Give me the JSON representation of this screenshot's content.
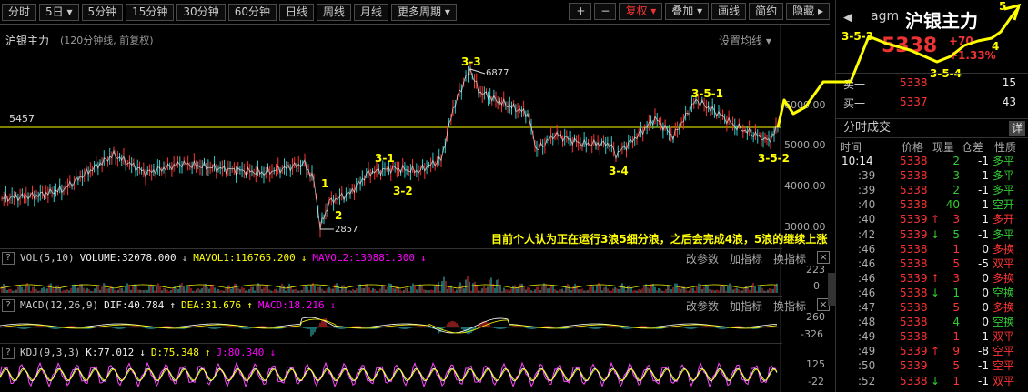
{
  "toolbar": {
    "left": [
      "分时",
      "5日 ▾",
      "5分钟",
      "15分钟",
      "30分钟",
      "60分钟",
      "日线",
      "周线",
      "月线",
      "更多周期 ▾"
    ],
    "right": [
      "+",
      "−",
      "复权 ▾",
      "叠加 ▾",
      "画线",
      "简约",
      "隐藏 ▸"
    ]
  },
  "chart": {
    "title": "沪银主力",
    "subtitle": "(120分钟线, 前复权)",
    "settings": "设置均线 ▾",
    "ref_line_label": "5457",
    "y_labels": [
      "6000.00",
      "5000.00",
      "4000.00",
      "3000.00"
    ],
    "high_note": "6877",
    "low_note": "2857",
    "waves": [
      "1",
      "2",
      "3-1",
      "3-2",
      "3-3",
      "3-4",
      "3-5-1",
      "3-5-2",
      "3-5-3",
      "3-5-4",
      "4",
      "5"
    ],
    "annotation": "目前个人认为正在运行3浪5细分浪，之后会完成4浪，5浪的继续上涨"
  },
  "vol": {
    "name": "VOL(5,10)",
    "volume": "VOLUME:32078.000",
    "ma1": "MAVOL1:116765.200",
    "ma2": "MAVOL2:130881.300",
    "y_labels": [
      "223",
      "0"
    ]
  },
  "macd": {
    "name": "MACD(12,26,9)",
    "dif": "DIF:40.784",
    "dea": "DEA:31.676",
    "macd": "MACD:18.216",
    "y_labels": [
      "260",
      "-326"
    ]
  },
  "kdj": {
    "name": "KDJ(9,3,3)",
    "k": "K:77.012",
    "d": "D:75.348",
    "j": "J:80.340",
    "y_labels": [
      "125",
      "-22"
    ]
  },
  "panel_tools": [
    "改参数",
    "加指标",
    "换指标"
  ],
  "quote": {
    "code": "agm",
    "name": "沪银主力",
    "price": "5338",
    "change": "+70",
    "pct": "+1.33%",
    "sell_label": "卖一",
    "sell_price": "5338",
    "sell_vol": "15",
    "buy_label": "买一",
    "buy_price": "5337",
    "buy_vol": "43"
  },
  "ticks": {
    "title": "分时成交",
    "detail": "详",
    "cols": [
      "时间",
      "价格",
      "现量",
      "仓差",
      "性质"
    ],
    "rows": [
      {
        "t": "10:14",
        "p": "5338",
        "a": "",
        "q": "2",
        "d": "-1",
        "n": "多平",
        "pc": "red",
        "nc": "green"
      },
      {
        "t": ":39",
        "p": "5338",
        "a": "",
        "q": "3",
        "d": "-1",
        "n": "多平",
        "pc": "red",
        "nc": "green"
      },
      {
        "t": ":39",
        "p": "5338",
        "a": "",
        "q": "2",
        "d": "-1",
        "n": "多平",
        "pc": "red",
        "nc": "green"
      },
      {
        "t": ":40",
        "p": "5338",
        "a": "",
        "q": "40",
        "d": "1",
        "n": "空开",
        "pc": "red",
        "nc": "green"
      },
      {
        "t": ":40",
        "p": "5339",
        "a": "↑",
        "q": "3",
        "d": "1",
        "n": "多开",
        "pc": "red",
        "nc": "red"
      },
      {
        "t": ":42",
        "p": "5339",
        "a": "↓",
        "q": "5",
        "d": "-1",
        "n": "多平",
        "pc": "red",
        "nc": "green"
      },
      {
        "t": ":46",
        "p": "5338",
        "a": "",
        "q": "1",
        "d": "0",
        "n": "多换",
        "pc": "red",
        "nc": "red"
      },
      {
        "t": ":46",
        "p": "5338",
        "a": "",
        "q": "5",
        "d": "-5",
        "n": "双平",
        "pc": "red",
        "nc": "red"
      },
      {
        "t": ":46",
        "p": "5339",
        "a": "↑",
        "q": "3",
        "d": "0",
        "n": "多换",
        "pc": "red",
        "nc": "red"
      },
      {
        "t": ":46",
        "p": "5338",
        "a": "↓",
        "q": "1",
        "d": "0",
        "n": "空换",
        "pc": "red",
        "nc": "green"
      },
      {
        "t": ":47",
        "p": "5338",
        "a": "",
        "q": "5",
        "d": "0",
        "n": "多换",
        "pc": "red",
        "nc": "red"
      },
      {
        "t": ":48",
        "p": "5338",
        "a": "",
        "q": "4",
        "d": "0",
        "n": "空换",
        "pc": "red",
        "nc": "green"
      },
      {
        "t": ":49",
        "p": "5338",
        "a": "",
        "q": "1",
        "d": "-1",
        "n": "双平",
        "pc": "red",
        "nc": "red"
      },
      {
        "t": ":49",
        "p": "5339",
        "a": "↑",
        "q": "9",
        "d": "-8",
        "n": "空平",
        "pc": "red",
        "nc": "red"
      },
      {
        "t": ":50",
        "p": "5339",
        "a": "",
        "q": "5",
        "d": "-1",
        "n": "空平",
        "pc": "red",
        "nc": "red"
      },
      {
        "t": ":52",
        "p": "5338",
        "a": "↓",
        "q": "1",
        "d": "-1",
        "n": "双平",
        "pc": "red",
        "nc": "red"
      }
    ]
  },
  "colors": {
    "up": "#ff3333",
    "down": "#33cc33",
    "accent": "#ffff00",
    "wave": "#ffff00"
  }
}
